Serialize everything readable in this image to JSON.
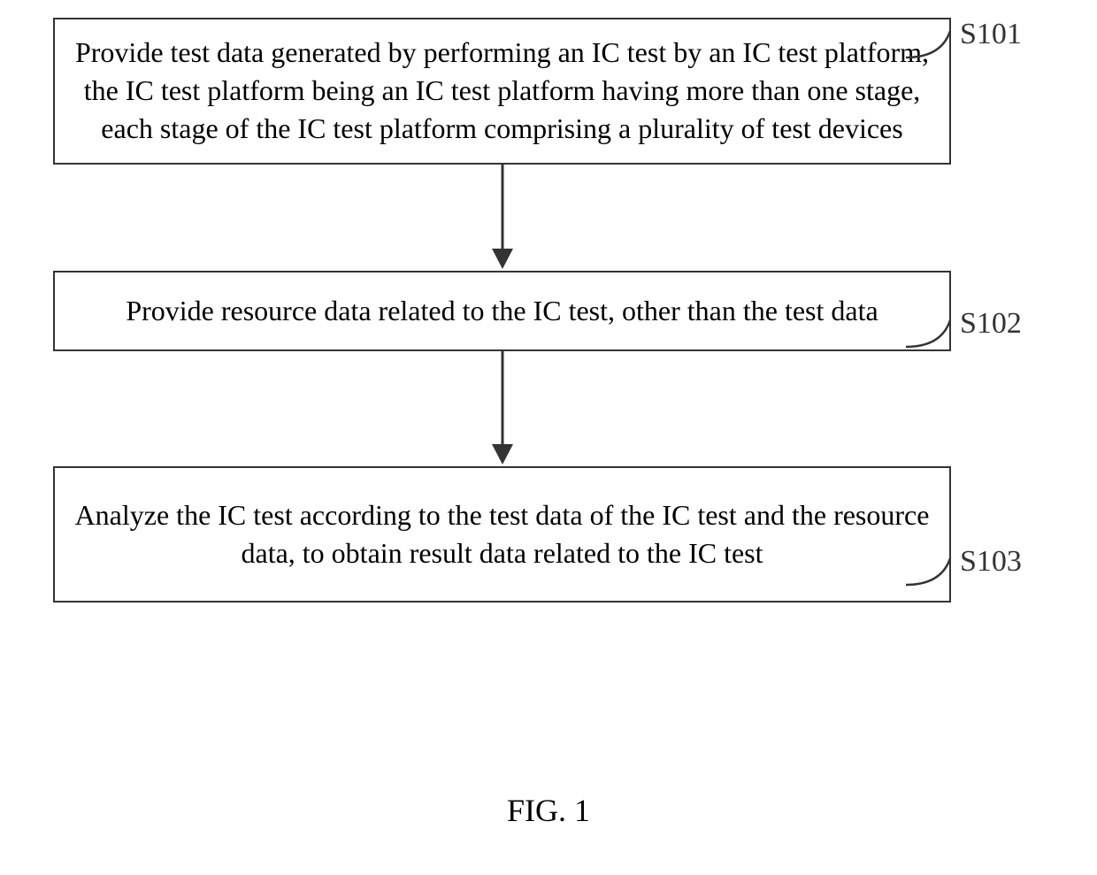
{
  "flowchart": {
    "steps": [
      {
        "id": "S101",
        "text": "Provide test data generated by performing an IC test by an IC test platform, the IC test platform being an IC test platform having more than one stage, each stage of the IC test platform comprising a plurality of test devices"
      },
      {
        "id": "S102",
        "text": "Provide resource data related to the IC test, other than the test data"
      },
      {
        "id": "S103",
        "text": "Analyze the IC test according to the test data of the IC test and the resource data, to obtain result data related to the IC test"
      }
    ]
  },
  "caption": "FIG. 1"
}
